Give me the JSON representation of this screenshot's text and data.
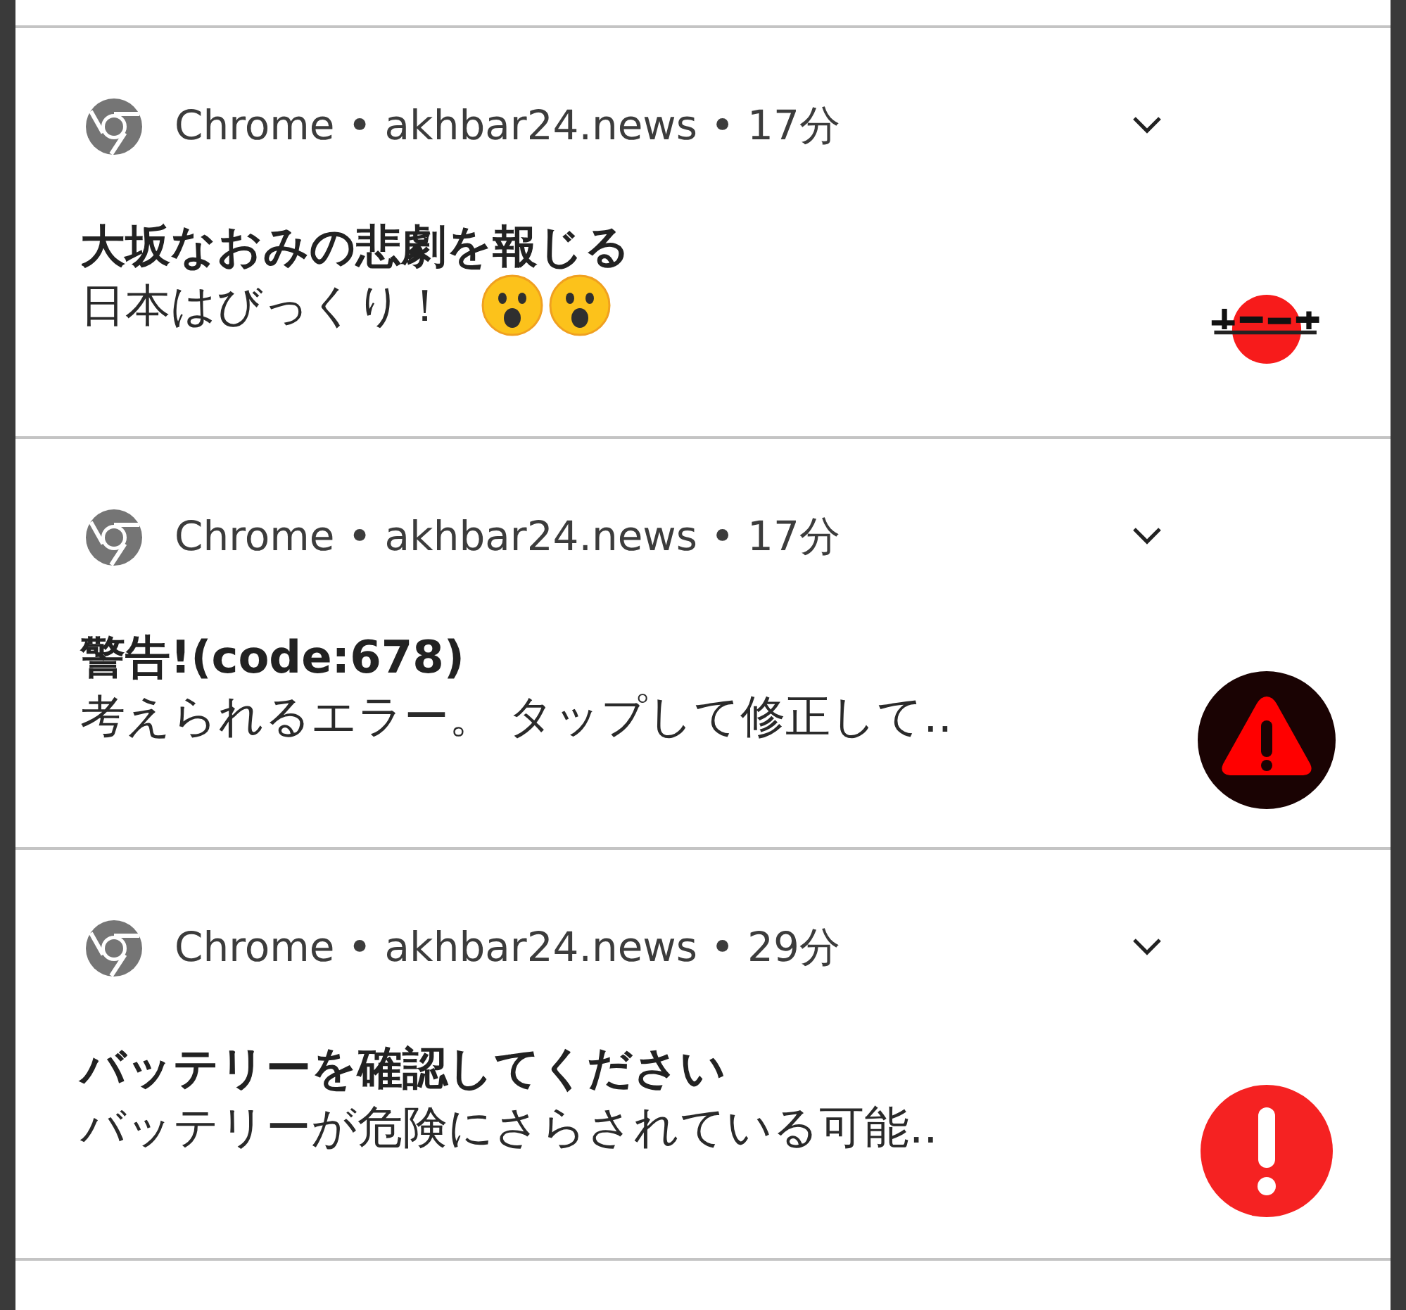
{
  "notifications": [
    {
      "header": "Chrome • akhbar24.news • 17分",
      "title": "大坂なおみの悲劇を報じる",
      "body": "日本はびっくり！",
      "emojis": [
        {
          "kind": "surprised"
        },
        {
          "kind": "surprised"
        }
      ],
      "large_icon": {
        "kind": "picture"
      }
    },
    {
      "header": "Chrome • akhbar24.news • 17分",
      "title": "警告!(code:678)",
      "body": "考えられるエラー。 タップして修正して..",
      "large_icon": {
        "kind": "warning"
      }
    },
    {
      "header": "Chrome • akhbar24.news • 29分",
      "title": "バッテリーを確認してください",
      "body": "バッテリーが危険にさらされている可能..",
      "large_icon": {
        "kind": "alert"
      }
    }
  ]
}
